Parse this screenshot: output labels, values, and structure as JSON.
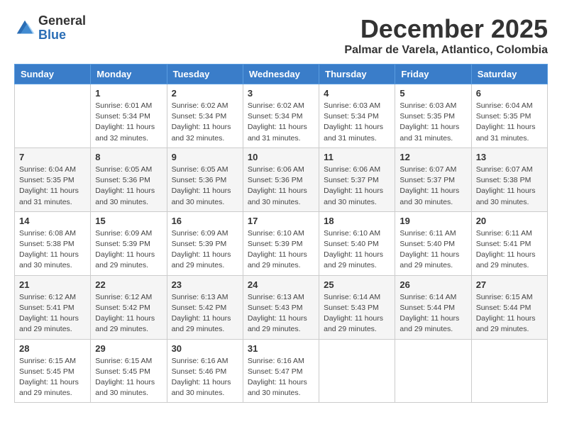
{
  "logo": {
    "general": "General",
    "blue": "Blue"
  },
  "title": "December 2025",
  "subtitle": "Palmar de Varela, Atlantico, Colombia",
  "weekdays": [
    "Sunday",
    "Monday",
    "Tuesday",
    "Wednesday",
    "Thursday",
    "Friday",
    "Saturday"
  ],
  "weeks": [
    [
      {
        "day": "",
        "info": ""
      },
      {
        "day": "1",
        "info": "Sunrise: 6:01 AM\nSunset: 5:34 PM\nDaylight: 11 hours\nand 32 minutes."
      },
      {
        "day": "2",
        "info": "Sunrise: 6:02 AM\nSunset: 5:34 PM\nDaylight: 11 hours\nand 32 minutes."
      },
      {
        "day": "3",
        "info": "Sunrise: 6:02 AM\nSunset: 5:34 PM\nDaylight: 11 hours\nand 31 minutes."
      },
      {
        "day": "4",
        "info": "Sunrise: 6:03 AM\nSunset: 5:34 PM\nDaylight: 11 hours\nand 31 minutes."
      },
      {
        "day": "5",
        "info": "Sunrise: 6:03 AM\nSunset: 5:35 PM\nDaylight: 11 hours\nand 31 minutes."
      },
      {
        "day": "6",
        "info": "Sunrise: 6:04 AM\nSunset: 5:35 PM\nDaylight: 11 hours\nand 31 minutes."
      }
    ],
    [
      {
        "day": "7",
        "info": "Sunrise: 6:04 AM\nSunset: 5:35 PM\nDaylight: 11 hours\nand 31 minutes."
      },
      {
        "day": "8",
        "info": "Sunrise: 6:05 AM\nSunset: 5:36 PM\nDaylight: 11 hours\nand 30 minutes."
      },
      {
        "day": "9",
        "info": "Sunrise: 6:05 AM\nSunset: 5:36 PM\nDaylight: 11 hours\nand 30 minutes."
      },
      {
        "day": "10",
        "info": "Sunrise: 6:06 AM\nSunset: 5:36 PM\nDaylight: 11 hours\nand 30 minutes."
      },
      {
        "day": "11",
        "info": "Sunrise: 6:06 AM\nSunset: 5:37 PM\nDaylight: 11 hours\nand 30 minutes."
      },
      {
        "day": "12",
        "info": "Sunrise: 6:07 AM\nSunset: 5:37 PM\nDaylight: 11 hours\nand 30 minutes."
      },
      {
        "day": "13",
        "info": "Sunrise: 6:07 AM\nSunset: 5:38 PM\nDaylight: 11 hours\nand 30 minutes."
      }
    ],
    [
      {
        "day": "14",
        "info": "Sunrise: 6:08 AM\nSunset: 5:38 PM\nDaylight: 11 hours\nand 30 minutes."
      },
      {
        "day": "15",
        "info": "Sunrise: 6:09 AM\nSunset: 5:39 PM\nDaylight: 11 hours\nand 29 minutes."
      },
      {
        "day": "16",
        "info": "Sunrise: 6:09 AM\nSunset: 5:39 PM\nDaylight: 11 hours\nand 29 minutes."
      },
      {
        "day": "17",
        "info": "Sunrise: 6:10 AM\nSunset: 5:39 PM\nDaylight: 11 hours\nand 29 minutes."
      },
      {
        "day": "18",
        "info": "Sunrise: 6:10 AM\nSunset: 5:40 PM\nDaylight: 11 hours\nand 29 minutes."
      },
      {
        "day": "19",
        "info": "Sunrise: 6:11 AM\nSunset: 5:40 PM\nDaylight: 11 hours\nand 29 minutes."
      },
      {
        "day": "20",
        "info": "Sunrise: 6:11 AM\nSunset: 5:41 PM\nDaylight: 11 hours\nand 29 minutes."
      }
    ],
    [
      {
        "day": "21",
        "info": "Sunrise: 6:12 AM\nSunset: 5:41 PM\nDaylight: 11 hours\nand 29 minutes."
      },
      {
        "day": "22",
        "info": "Sunrise: 6:12 AM\nSunset: 5:42 PM\nDaylight: 11 hours\nand 29 minutes."
      },
      {
        "day": "23",
        "info": "Sunrise: 6:13 AM\nSunset: 5:42 PM\nDaylight: 11 hours\nand 29 minutes."
      },
      {
        "day": "24",
        "info": "Sunrise: 6:13 AM\nSunset: 5:43 PM\nDaylight: 11 hours\nand 29 minutes."
      },
      {
        "day": "25",
        "info": "Sunrise: 6:14 AM\nSunset: 5:43 PM\nDaylight: 11 hours\nand 29 minutes."
      },
      {
        "day": "26",
        "info": "Sunrise: 6:14 AM\nSunset: 5:44 PM\nDaylight: 11 hours\nand 29 minutes."
      },
      {
        "day": "27",
        "info": "Sunrise: 6:15 AM\nSunset: 5:44 PM\nDaylight: 11 hours\nand 29 minutes."
      }
    ],
    [
      {
        "day": "28",
        "info": "Sunrise: 6:15 AM\nSunset: 5:45 PM\nDaylight: 11 hours\nand 29 minutes."
      },
      {
        "day": "29",
        "info": "Sunrise: 6:15 AM\nSunset: 5:45 PM\nDaylight: 11 hours\nand 30 minutes."
      },
      {
        "day": "30",
        "info": "Sunrise: 6:16 AM\nSunset: 5:46 PM\nDaylight: 11 hours\nand 30 minutes."
      },
      {
        "day": "31",
        "info": "Sunrise: 6:16 AM\nSunset: 5:47 PM\nDaylight: 11 hours\nand 30 minutes."
      },
      {
        "day": "",
        "info": ""
      },
      {
        "day": "",
        "info": ""
      },
      {
        "day": "",
        "info": ""
      }
    ]
  ]
}
